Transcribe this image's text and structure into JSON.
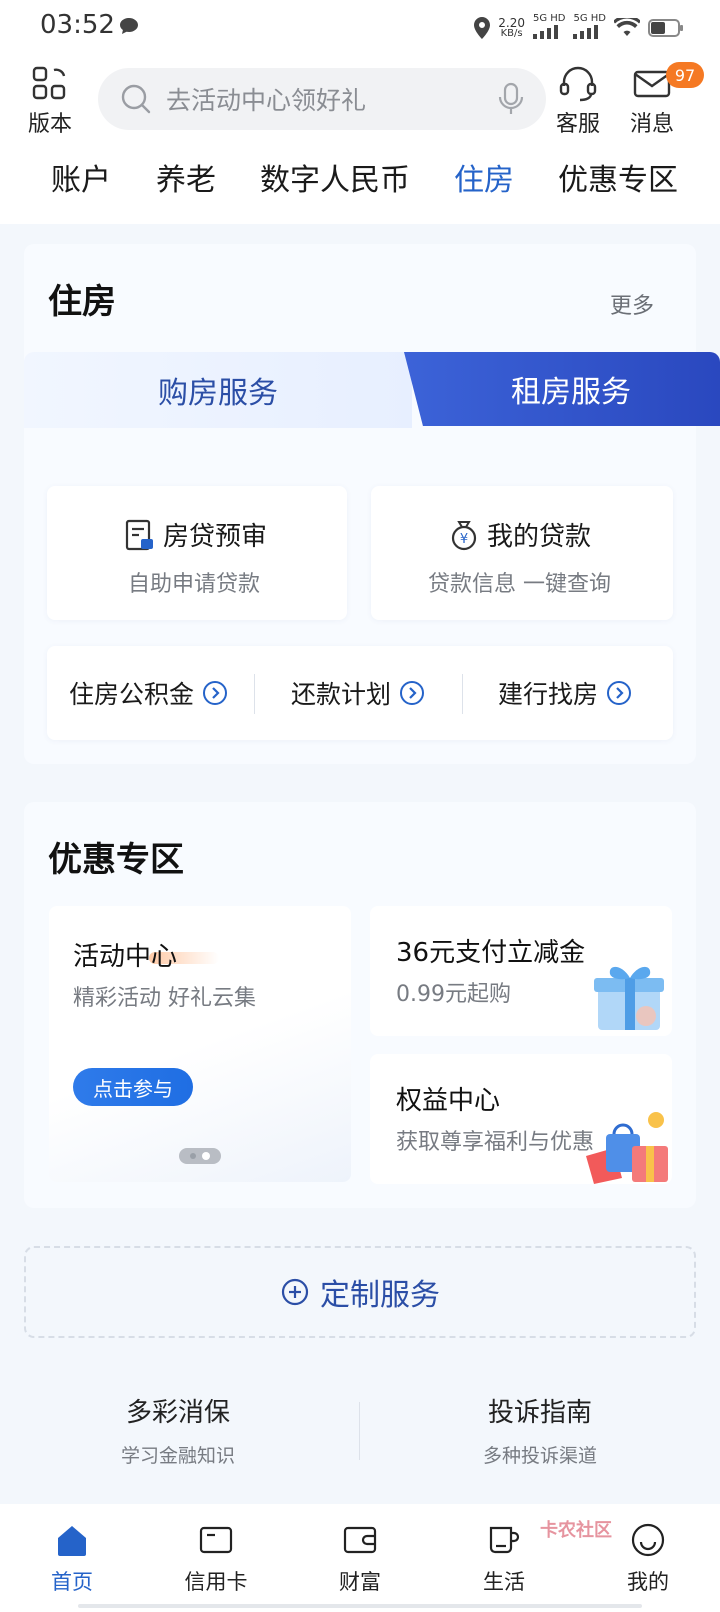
{
  "status_bar": {
    "time": "03:52",
    "speed_value": "2.20",
    "speed_unit": "KB/s",
    "net1": "5G HD",
    "net2": "5G HD"
  },
  "header": {
    "version_label": "版本",
    "search_placeholder": "去活动中心领好礼",
    "service_label": "客服",
    "message_label": "消息",
    "message_badge": "97"
  },
  "tabs": [
    "账户",
    "养老",
    "数字人民币",
    "住房",
    "优惠专区"
  ],
  "housing": {
    "title": "住房",
    "more": "更多",
    "seg_buy": "购房服务",
    "seg_rent": "租房服务",
    "tiles": [
      {
        "title": "房贷预审",
        "sub": "自助申请贷款"
      },
      {
        "title": "我的贷款",
        "sub": "贷款信息 一键查询"
      }
    ],
    "links": [
      "住房公积金",
      "还款计划",
      "建行找房"
    ]
  },
  "promo": {
    "title": "优惠专区",
    "activity": {
      "title": "活动中心",
      "sub": "精彩活动 好礼云集",
      "button": "点击参与"
    },
    "cards": [
      {
        "title": "36元支付立减金",
        "sub": "0.99元起购"
      },
      {
        "title": "权益中心",
        "sub": "获取尊享福利与优惠"
      }
    ]
  },
  "custom_service": "定制服务",
  "footer_links": [
    {
      "title": "多彩消保",
      "sub": "学习金融知识"
    },
    {
      "title": "投诉指南",
      "sub": "多种投诉渠道"
    }
  ],
  "bottom_nav": [
    "首页",
    "信用卡",
    "财富",
    "生活",
    "我的"
  ],
  "watermark": "卡农社区",
  "colors": {
    "accent": "#2563c9",
    "badge": "#f57923",
    "segment_active": "#2a48bf"
  }
}
